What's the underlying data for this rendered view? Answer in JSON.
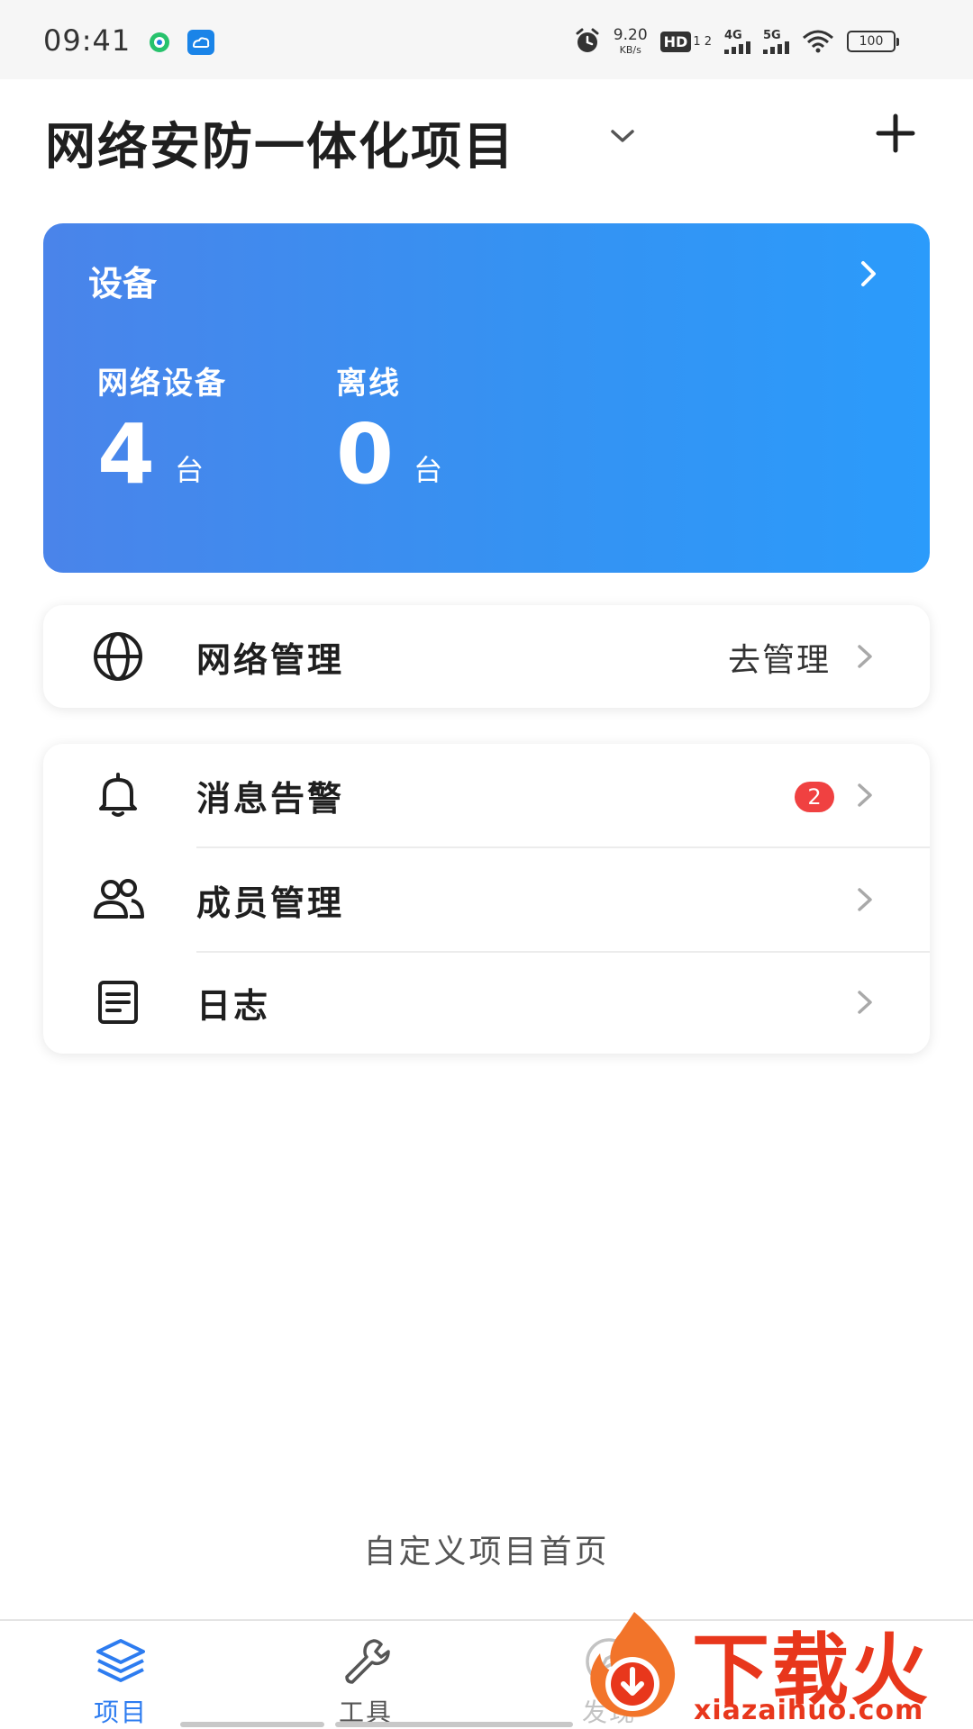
{
  "status_bar": {
    "time": "09:41",
    "net_speed": "9.20",
    "net_speed_unit": "KB/s",
    "hd_label": "HD",
    "hd_sub": "1 2",
    "sim1": "4G",
    "sim2": "5G",
    "battery": "100"
  },
  "header": {
    "project_title": "网络安防一体化项目"
  },
  "device_card": {
    "title": "设备",
    "stats": [
      {
        "label": "网络设备",
        "value": "4",
        "unit": "台"
      },
      {
        "label": "离线",
        "value": "0",
        "unit": "台"
      }
    ]
  },
  "network_card": {
    "label": "网络管理",
    "action": "去管理"
  },
  "list_card": {
    "items": [
      {
        "label": "消息告警",
        "badge": "2"
      },
      {
        "label": "成员管理"
      },
      {
        "label": "日志"
      }
    ]
  },
  "customize_link": "自定义项目首页",
  "bottom_nav": {
    "tabs": [
      {
        "label": "项目",
        "icon": "layers-icon",
        "active": true
      },
      {
        "label": "工具",
        "icon": "wrench-icon",
        "active": false
      },
      {
        "label": "发现",
        "icon": "compass-icon",
        "active": false
      }
    ]
  },
  "watermark": {
    "text": "下载火",
    "url": "xiazaihuo.com"
  },
  "colors": {
    "accent": "#2d7cf0",
    "card_gradient_start": "#4a84ea",
    "card_gradient_end": "#2b9bfb",
    "badge": "#f04141",
    "watermark": "#e8371c"
  }
}
